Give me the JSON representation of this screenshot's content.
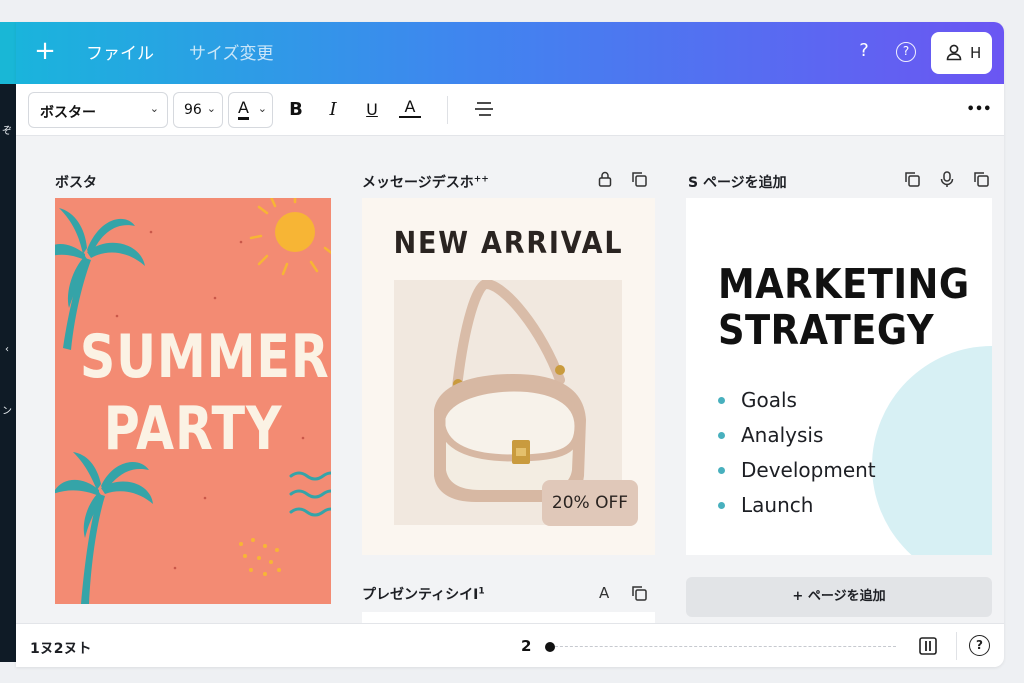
{
  "topbar": {
    "add_icon": "plus-icon",
    "menu": [
      "ファイル",
      "サイズ変更"
    ],
    "help_label": "?",
    "help_circle_label": "?",
    "account_initial": "H"
  },
  "toolbar": {
    "font": "ボスター",
    "size": "96",
    "color_letter": "A",
    "bold": "B",
    "italic": "I",
    "underline": "U",
    "strike": "A",
    "more": "•••"
  },
  "pages": [
    {
      "label": "ボスタ"
    },
    {
      "label": "メッセージデスホ",
      "sup": "++"
    },
    {
      "label": "S ページを追加"
    }
  ],
  "summer": {
    "line1": "SUMMER",
    "line2": "PARTY"
  },
  "arrival": {
    "title": "NEW ARRIVAL",
    "badge": "20% OFF"
  },
  "marketing": {
    "line1": "MARKETING",
    "line2": "STRATEGY",
    "items": [
      "Goals",
      "Analysis",
      "Development",
      "Launch"
    ],
    "accent": "#48b0be"
  },
  "add_page_button": "+ ページを追加",
  "fourth_page": {
    "label": "プレゼンティシイI",
    "sup": "1",
    "icon_letter": "A"
  },
  "footer": {
    "left": "1ヌ2ヌト",
    "page": "2",
    "help": "?"
  },
  "colors": {
    "summer_bg": "#f38b73",
    "palm": "#35a4a8",
    "sun": "#f7b535",
    "gradient_start": "#1ab4dc",
    "gradient_end": "#6b56f3"
  },
  "left_strip": {
    "marks": [
      "ぞ",
      "‹",
      "ン"
    ]
  }
}
